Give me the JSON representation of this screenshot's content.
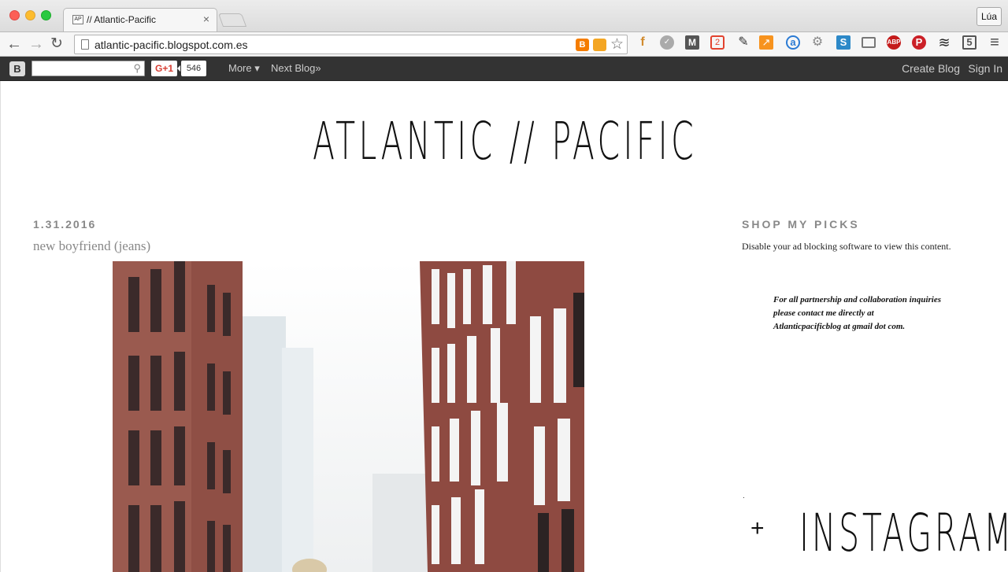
{
  "browser": {
    "tab_title": "// Atlantic-Pacific",
    "tab_favicon": "AP",
    "profile_name": "Lúa",
    "url": "atlantic-pacific.blogspot.com.es",
    "extensions": [
      "reader-icon",
      "block-icon",
      "m-icon",
      "badge-2-icon",
      "pen-icon",
      "chart-icon",
      "a-icon",
      "gear-icon",
      "s-icon",
      "cast-icon",
      "adblock-icon",
      "pinterest-icon",
      "layers-icon",
      "html5-icon",
      "menu-icon"
    ]
  },
  "blogger_bar": {
    "gplus_label": "G+1",
    "gplus_count": "546",
    "more_label": "More ▾",
    "next_blog_label": "Next Blog»",
    "create_blog_label": "Create Blog",
    "sign_in_label": "Sign In"
  },
  "blog": {
    "title": "ATLANTIC // PACIFIC"
  },
  "post": {
    "date": "1.31.2016",
    "title": "new boyfriend (jeans)"
  },
  "sidebar": {
    "heading": "SHOP MY PICKS",
    "note": "Disable your ad blocking software to view this content.",
    "inquiry_lines": [
      "For all partnership and collaboration inquiries",
      "please contact me directly at",
      "Atlanticpacificblog at gmail dot com."
    ],
    "dot": ".",
    "instagram_plus": "+",
    "instagram_title": "INSTAGRAM"
  }
}
